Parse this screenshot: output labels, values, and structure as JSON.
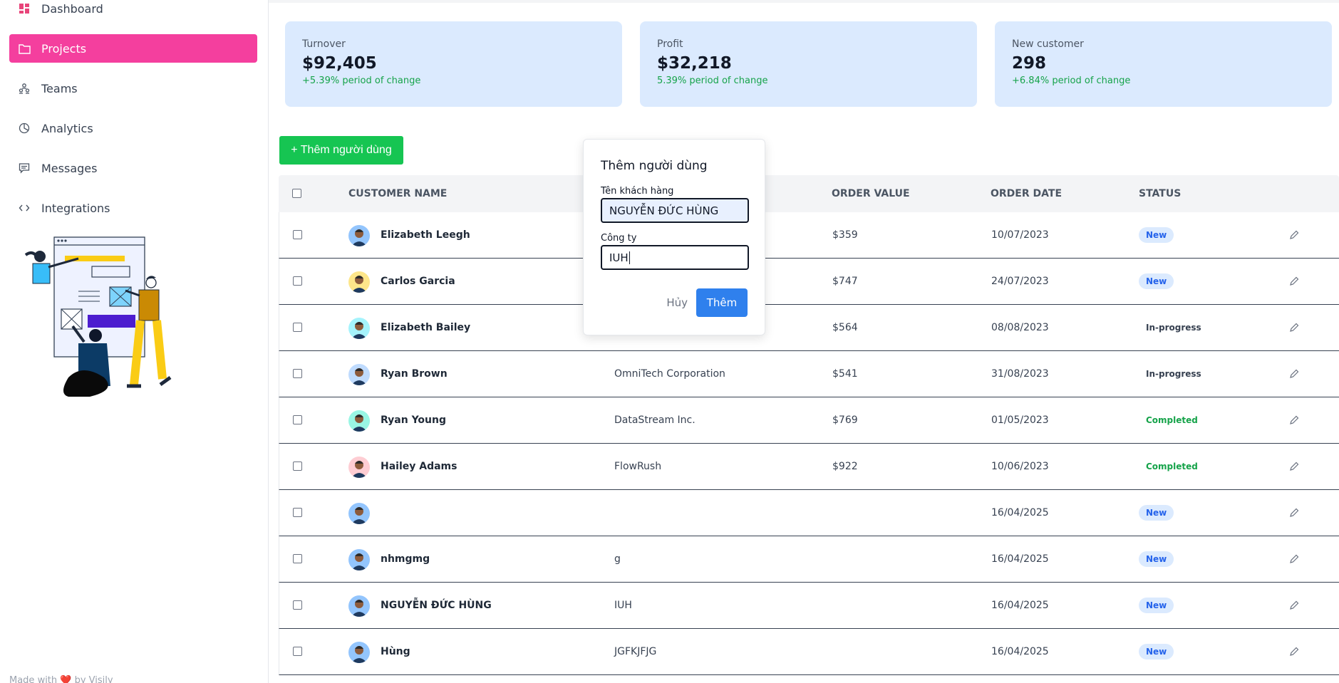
{
  "sidebar": {
    "items": [
      {
        "label": "Dashboard",
        "icon": "dashboard-icon"
      },
      {
        "label": "Projects",
        "icon": "folder-icon",
        "active": true
      },
      {
        "label": "Teams",
        "icon": "teams-icon"
      },
      {
        "label": "Analytics",
        "icon": "pie-chart-icon"
      },
      {
        "label": "Messages",
        "icon": "message-icon"
      },
      {
        "label": "Integrations",
        "icon": "code-icon"
      }
    ],
    "footer": "Made with ❤️ by Visily"
  },
  "stats": [
    {
      "label": "Turnover",
      "value": "$92,405",
      "change": "+5.39% period of change"
    },
    {
      "label": "Profit",
      "value": "$32,218",
      "change": "5.39% period of change"
    },
    {
      "label": "New customer",
      "value": "298",
      "change": "+6.84% period of change"
    }
  ],
  "add_button": "+ Thêm người dùng",
  "table": {
    "headers": {
      "name": "CUSTOMER NAME",
      "value": "ORDER VALUE",
      "date": "ORDER DATE",
      "status": "STATUS"
    },
    "rows": [
      {
        "name": "Elizabeth Leegh",
        "company": "",
        "value": "$359",
        "date": "10/07/2023",
        "status": "New",
        "avatar_color": "#93c5fd"
      },
      {
        "name": "Carlos Garcia",
        "company": "",
        "value": "$747",
        "date": "24/07/2023",
        "status": "New",
        "avatar_color": "#fde68a"
      },
      {
        "name": "Elizabeth Bailey",
        "company": "",
        "value": "$564",
        "date": "08/08/2023",
        "status": "In-progress",
        "avatar_color": "#a5f3fc"
      },
      {
        "name": "Ryan Brown",
        "company": "OmniTech Corporation",
        "value": "$541",
        "date": "31/08/2023",
        "status": "In-progress",
        "avatar_color": "#bfdbfe"
      },
      {
        "name": "Ryan Young",
        "company": "DataStream Inc.",
        "value": "$769",
        "date": "01/05/2023",
        "status": "Completed",
        "avatar_color": "#99f6e4"
      },
      {
        "name": "Hailey Adams",
        "company": "FlowRush",
        "value": "$922",
        "date": "10/06/2023",
        "status": "Completed",
        "avatar_color": "#fecdd3"
      },
      {
        "name": "",
        "company": "",
        "value": "",
        "date": "16/04/2025",
        "status": "New",
        "avatar_color": "#93c5fd"
      },
      {
        "name": "nhmgmg",
        "company": "g",
        "value": "",
        "date": "16/04/2025",
        "status": "New",
        "avatar_color": "#93c5fd"
      },
      {
        "name": "NGUYỄN ĐỨC HÙNG",
        "company": "IUH",
        "value": "",
        "date": "16/04/2025",
        "status": "New",
        "avatar_color": "#93c5fd"
      },
      {
        "name": "Hùng",
        "company": "JGFKJFJG",
        "value": "",
        "date": "16/04/2025",
        "status": "New",
        "avatar_color": "#93c5fd"
      }
    ]
  },
  "modal": {
    "title": "Thêm người dùng",
    "name_label": "Tên khách hàng",
    "name_value": "NGUYỄN ĐỨC HÙNG",
    "company_label": "Công ty",
    "company_value": "IUH",
    "cancel": "Hủy",
    "submit": "Thêm"
  },
  "colors": {
    "accent": "#f43f9e",
    "card_bg": "#dbeafe",
    "primary": "#2f80ed",
    "success": "#16c552"
  }
}
